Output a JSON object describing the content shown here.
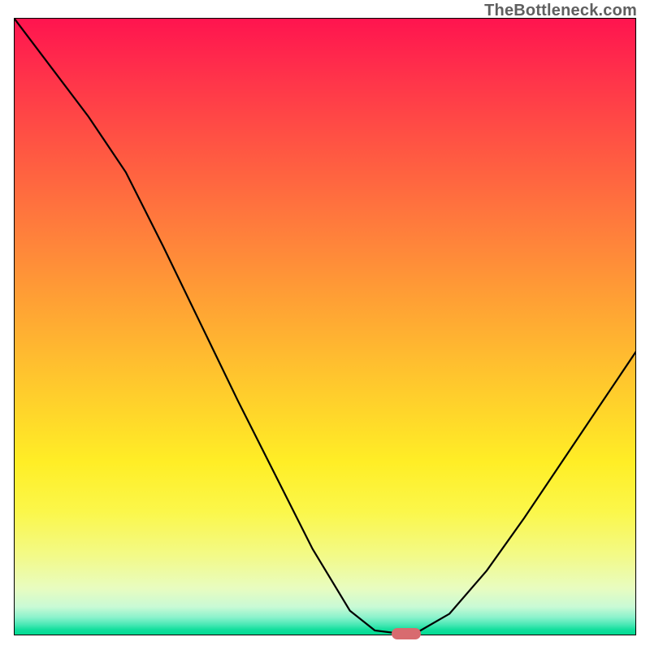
{
  "attribution": "TheBottleneck.com",
  "chart_data": {
    "type": "line",
    "title": "",
    "xlabel": "",
    "ylabel": "",
    "xlim": [
      0,
      100
    ],
    "ylim": [
      0,
      100
    ],
    "series": [
      {
        "name": "curve",
        "x": [
          0,
          6,
          12,
          18,
          24,
          30,
          36,
          42,
          48,
          54,
          58,
          62,
          64.5,
          70,
          76,
          82,
          88,
          94,
          100
        ],
        "values": [
          100,
          92,
          84,
          75,
          63,
          50.5,
          38,
          26,
          14,
          4,
          0.8,
          0.3,
          0.3,
          3.5,
          10.5,
          19,
          28,
          37,
          46
        ]
      }
    ],
    "marker": {
      "x_pct": 63,
      "y_pct": 0.2
    },
    "colors": {
      "gradient_top": "#ff144f",
      "gradient_bottom": "#00da92",
      "curve": "#000000",
      "marker": "#d86b6f"
    }
  }
}
